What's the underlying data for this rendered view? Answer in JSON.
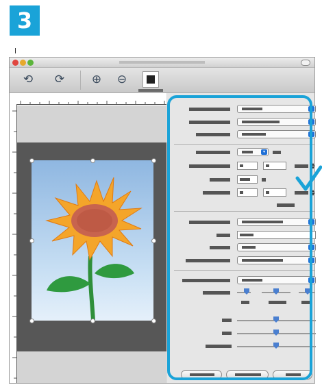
{
  "step": {
    "number": "3"
  },
  "window": {
    "title": ""
  },
  "toolbar": {
    "buttons": [
      {
        "name": "rotate-left",
        "glyph": "⟲"
      },
      {
        "name": "rotate-right",
        "glyph": "⟳"
      },
      {
        "name": "zoom-in",
        "glyph": "⊕"
      },
      {
        "name": "zoom-out",
        "glyph": "⊖"
      },
      {
        "name": "overview",
        "glyph": "■"
      }
    ]
  },
  "preview": {
    "image_subject": "sunflower"
  },
  "colors": {
    "accent": "#1aa3d8",
    "popup_arrow": "#1e6fd6",
    "dark_bed": "#575757"
  },
  "callout": {
    "icon": "checkmark-icon"
  }
}
